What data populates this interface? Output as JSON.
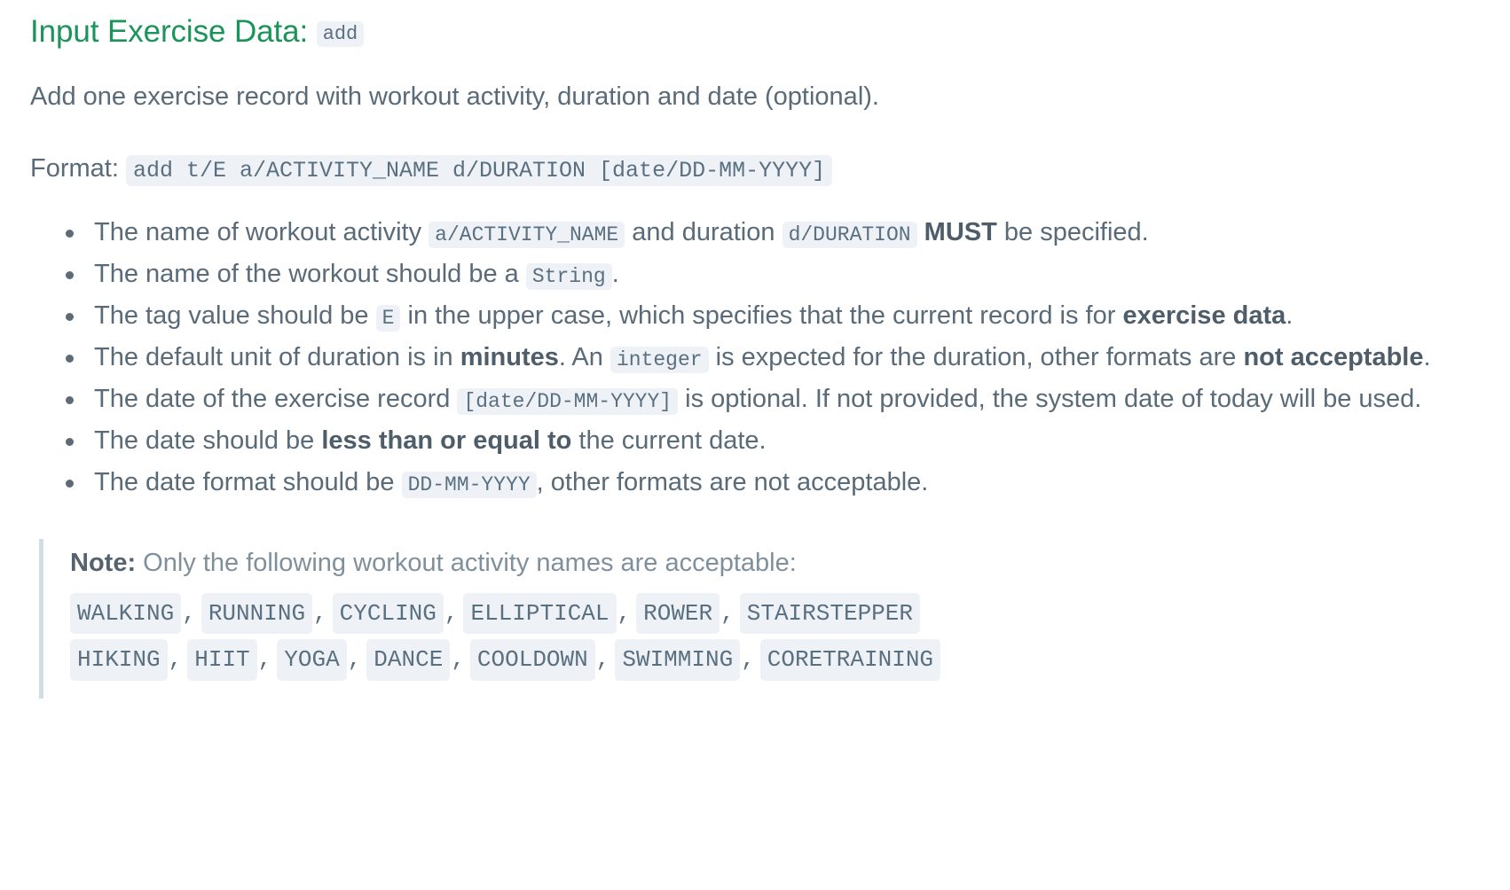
{
  "heading": {
    "title": "Input Exercise Data:",
    "command": "add"
  },
  "description": "Add one exercise record with workout activity, duration and date (optional).",
  "format": {
    "label": "Format:",
    "value": "add t/E a/ACTIVITY_NAME d/DURATION [date/DD-MM-YYYY]"
  },
  "rules": [
    {
      "parts": [
        {
          "t": "text",
          "v": "The name of workout activity "
        },
        {
          "t": "code",
          "v": "a/ACTIVITY_NAME"
        },
        {
          "t": "text",
          "v": " and duration "
        },
        {
          "t": "code",
          "v": "d/DURATION"
        },
        {
          "t": "text",
          "v": " "
        },
        {
          "t": "bold",
          "v": "MUST"
        },
        {
          "t": "text",
          "v": " be specified."
        }
      ]
    },
    {
      "parts": [
        {
          "t": "text",
          "v": "The name of the workout should be a "
        },
        {
          "t": "code",
          "v": "String"
        },
        {
          "t": "text",
          "v": "."
        }
      ]
    },
    {
      "parts": [
        {
          "t": "text",
          "v": "The tag value should be "
        },
        {
          "t": "code",
          "v": "E"
        },
        {
          "t": "text",
          "v": " in the upper case, which specifies that the current record is for "
        },
        {
          "t": "bold",
          "v": "exercise data"
        },
        {
          "t": "text",
          "v": "."
        }
      ]
    },
    {
      "parts": [
        {
          "t": "text",
          "v": "The default unit of duration is in "
        },
        {
          "t": "bold",
          "v": "minutes"
        },
        {
          "t": "text",
          "v": ". An "
        },
        {
          "t": "code",
          "v": "integer"
        },
        {
          "t": "text",
          "v": " is expected for the duration, other formats are "
        },
        {
          "t": "bold",
          "v": "not acceptable"
        },
        {
          "t": "text",
          "v": "."
        }
      ]
    },
    {
      "parts": [
        {
          "t": "text",
          "v": "The date of the exercise record "
        },
        {
          "t": "code",
          "v": "[date/DD-MM-YYYY]"
        },
        {
          "t": "text",
          "v": " is optional. If not provided, the system date of today will be used."
        }
      ]
    },
    {
      "parts": [
        {
          "t": "text",
          "v": "The date should be "
        },
        {
          "t": "bold",
          "v": "less than or equal to"
        },
        {
          "t": "text",
          "v": " the current date."
        }
      ]
    },
    {
      "parts": [
        {
          "t": "text",
          "v": "The date format should be "
        },
        {
          "t": "code",
          "v": "DD-MM-YYYY"
        },
        {
          "t": "text",
          "v": ", other formats are not acceptable."
        }
      ]
    }
  ],
  "note": {
    "label": "Note:",
    "text": " Only the following workout activity names are acceptable:",
    "activity_rows": [
      [
        "WALKING",
        "RUNNING",
        "CYCLING",
        "ELLIPTICAL",
        "ROWER",
        "STAIRSTEPPER"
      ],
      [
        "HIKING",
        "HIIT",
        "YOGA",
        "DANCE",
        "COOLDOWN",
        "SWIMMING",
        "CORETRAINING"
      ]
    ],
    "separator": ","
  },
  "colors": {
    "heading": "#1a9459",
    "body_text": "#596a78",
    "code_bg": "#eef2f7",
    "code_text": "#5a6f80",
    "note_border": "#d3dde5"
  }
}
